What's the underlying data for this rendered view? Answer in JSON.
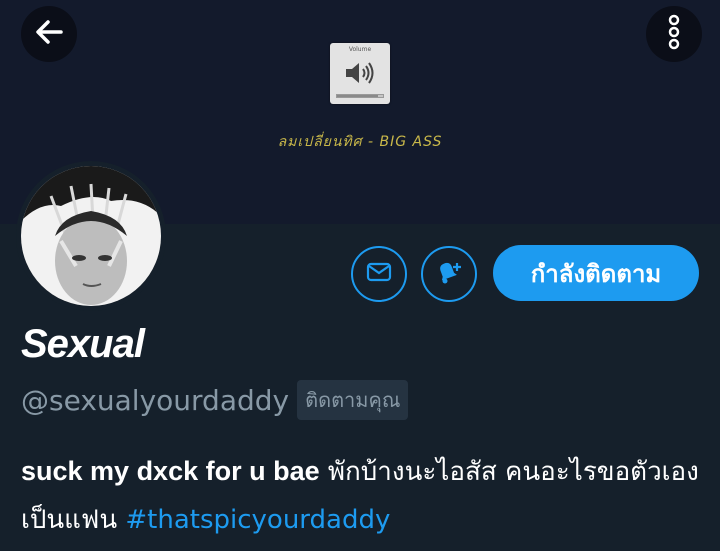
{
  "header": {
    "back_icon": "arrow-left-icon",
    "more_icon": "more-vertical-icon"
  },
  "banner": {
    "volume_label": "Volume",
    "volume_level": 0.9,
    "song_title": "ลมเปลี่ยนทิศ - BIG ASS"
  },
  "actions": {
    "message_icon": "mail-icon",
    "notify_icon": "bell-plus-icon",
    "follow_label": "กำลังติดตาม"
  },
  "profile": {
    "display_name": "Sexual",
    "handle": "@sexualyourdaddy",
    "follows_you": "ติดตามคุณ",
    "bio_bold": "suck my dxck for u bae",
    "bio_text": " พักบ้างนะไอสัส คนอะไรขอตัวเองเป็นแฟน ",
    "bio_hashtag": "#thatspicyourdaddy"
  },
  "colors": {
    "accent": "#1d9bf0",
    "background": "#15202b",
    "banner": "#131a2c",
    "muted_text": "#8899a6"
  }
}
